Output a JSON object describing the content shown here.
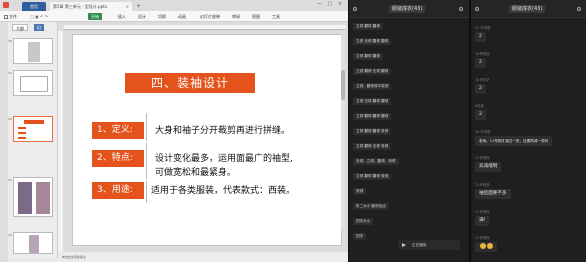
{
  "app": {
    "tabs": {
      "home": "首页",
      "document": "第5章 第三单元 - 型设计.pptx"
    },
    "menu": [
      "文件",
      "开始",
      "插入",
      "设计",
      "切换",
      "动画",
      "幻灯片放映",
      "审阅",
      "视图",
      "工具"
    ],
    "thumb_tabs": {
      "outline": "大纲",
      "slides": "幻"
    },
    "slide_numbers": [
      "18",
      "19",
      "20",
      "21",
      "22"
    ],
    "slide": {
      "title": "四、装袖设计",
      "rows": [
        {
          "label": "1、定义:",
          "text": [
            "大身和袖子分开裁剪再进行拼缝。"
          ]
        },
        {
          "label": "2、特点:",
          "text": [
            "设计变化最多，运用面最广的袖型,",
            "可做宽松和最紧身。"
          ]
        },
        {
          "label": "3、用途:",
          "text": [
            "适用于各类服装，代表款式：西装。"
          ]
        }
      ]
    },
    "status": "单击此处添加备注"
  },
  "chat_list": {
    "header_title": "服装成衣(43)",
    "messages": [
      {
        "meta": "",
        "text": "立领 翻领 翻领"
      },
      {
        "meta": "",
        "text": "立领 无领 翻领 翻领"
      },
      {
        "meta": "",
        "text": "立领 翻领 翻领"
      },
      {
        "meta": "",
        "text": "立领 翻领 无领 翻领"
      },
      {
        "meta": "",
        "text": "立领，翻领驳平驳领"
      },
      {
        "meta": "",
        "text": "立领 无领 翻领 翻领"
      },
      {
        "meta": "",
        "text": "立领 翻领 翻领 翻领"
      },
      {
        "meta": "",
        "text": "立领 翻领 翻领 驳领"
      },
      {
        "meta": "",
        "text": "立领 翻领 无领 驳领"
      },
      {
        "meta": "",
        "text": "无领，立领，翻领，驳领"
      },
      {
        "meta": "",
        "text": "立领 翻领 翻领 驳领"
      },
      {
        "meta": "",
        "text": "驳领"
      },
      {
        "meta": "",
        "text": "折二大小 取材优点"
      },
      {
        "meta": "",
        "text": "四字大小"
      },
      {
        "meta": "",
        "text": "四字"
      }
    ],
    "audio_label": "正在播放"
  },
  "chat_detail": {
    "header_title": "服装成衣(43)",
    "messages": [
      {
        "meta": "05 学号是",
        "text": "2"
      },
      {
        "meta": "18号阳西",
        "text": "2"
      },
      {
        "meta": "16号同学",
        "text": "2"
      },
      {
        "meta": "8班鑫",
        "text": "2"
      },
      {
        "meta": "06 学号是",
        "text": "老师。11号刚才减过一张，还要再减一张吗"
      },
      {
        "meta": "22号熊扬",
        "text": "双减缝制"
      },
      {
        "meta": "22号熊扬",
        "text": "袖后面要不多"
      },
      {
        "meta": "22号熊扬",
        "text": "满!"
      },
      {
        "meta": "22号熊扬",
        "text": ""
      }
    ]
  }
}
